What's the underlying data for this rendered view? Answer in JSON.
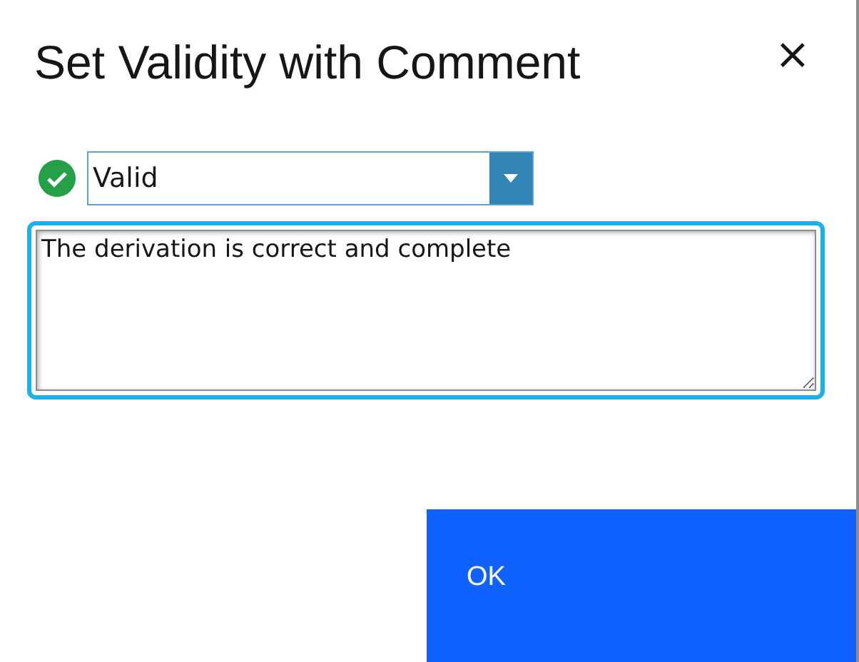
{
  "dialog": {
    "title": "Set Validity with Comment",
    "close": "×"
  },
  "validity": {
    "valid": true,
    "value": "Valid"
  },
  "comment": {
    "value": "The derivation is correct and complete",
    "focused": true
  },
  "buttons": [
    {
      "label": "OK",
      "kind": "primary"
    }
  ]
}
